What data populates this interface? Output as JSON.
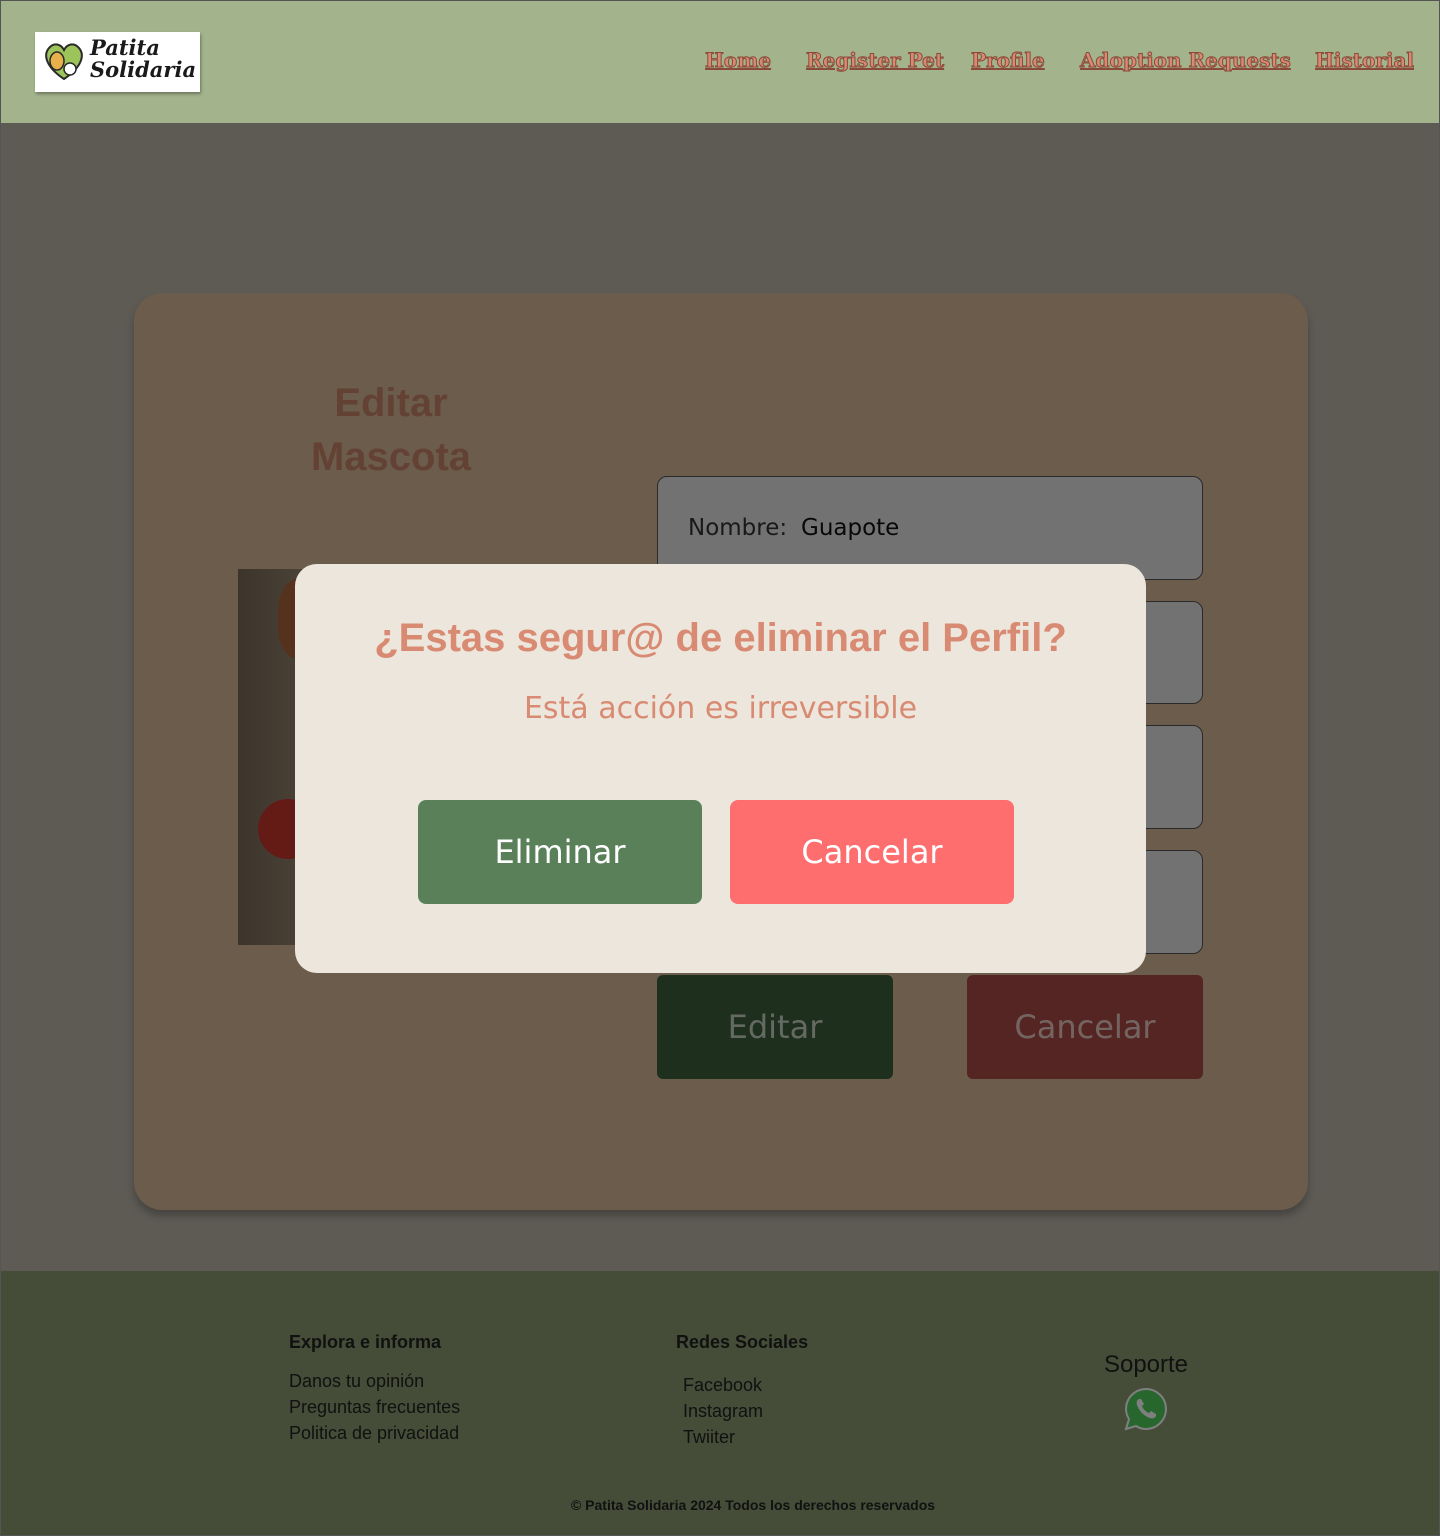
{
  "header": {
    "logo_text_line1": "Patita",
    "logo_text_line2": "Solidaria",
    "nav": [
      {
        "label": "Home"
      },
      {
        "label": "Register Pet"
      },
      {
        "label": "Profile"
      },
      {
        "label": "Adoption Requests"
      },
      {
        "label": "Historial"
      }
    ]
  },
  "card": {
    "title": "Editar Mascota",
    "fields": [
      {
        "label": "Nombre:",
        "value": "Guapote"
      },
      {
        "label": "",
        "value": ""
      },
      {
        "label": "",
        "value": ""
      },
      {
        "label": "",
        "value": ""
      }
    ],
    "edit_label": "Editar",
    "cancel_label": "Cancelar"
  },
  "modal": {
    "title": "¿Estas segur@ de eliminar el Perfil?",
    "subtitle": "Está acción es irreversible",
    "delete_label": "Eliminar",
    "cancel_label": "Cancelar"
  },
  "footer": {
    "explore_heading": "Explora e informa",
    "explore_links": [
      "Danos tu opinión",
      "Preguntas frecuentes",
      "Politica de privacidad"
    ],
    "social_heading": "Redes Sociales",
    "social_links": [
      "Facebook",
      "Instagram",
      "Twiiter"
    ],
    "support_heading": "Soporte",
    "support_icon": "whatsapp-icon",
    "copyright": "© Patita Solidaria 2024 Todos los derechos reservados"
  },
  "colors": {
    "header_bg": "#a3b48d",
    "accent": "#d98a72",
    "delete_button": "#5a8059",
    "cancel_button": "#ff6e6e",
    "modal_bg": "#ece6dc"
  }
}
